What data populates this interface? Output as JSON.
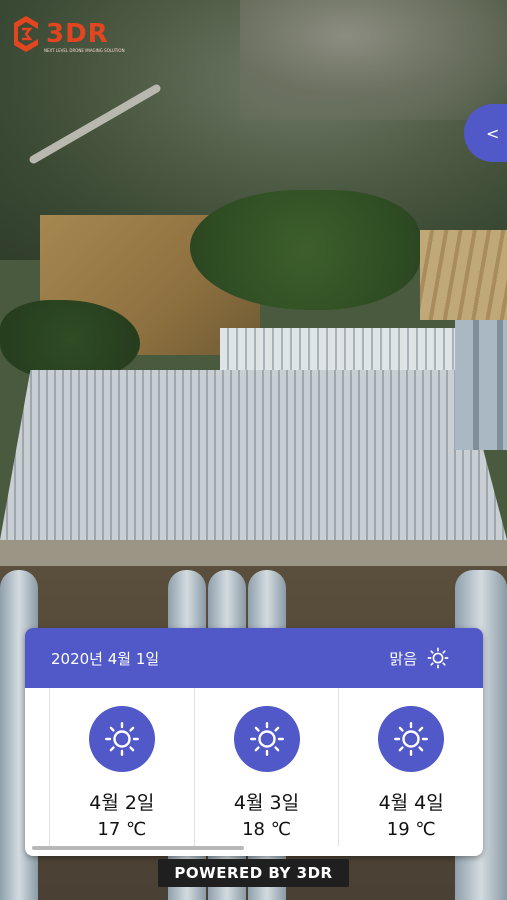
{
  "logo": {
    "text": "3DR",
    "subtext": "NEXT LEVEL DRONE IMAGING SOLUTION"
  },
  "side_toggle": {
    "label": "<"
  },
  "weather": {
    "current_date": "2020년 4월 1일",
    "current_condition": "맑음",
    "current_icon": "sun-icon",
    "forecast": [
      {
        "date": "4월 2일",
        "temp": "17 ℃",
        "icon": "sun-icon"
      },
      {
        "date": "4월 3일",
        "temp": "18 ℃",
        "icon": "sun-icon"
      },
      {
        "date": "4월 4일",
        "temp": "19 ℃",
        "icon": "sun-icon"
      }
    ]
  },
  "footer": {
    "powered_by": "POWERED BY 3DR"
  },
  "colors": {
    "accent": "#5158c8",
    "logo": "#e2451f"
  }
}
